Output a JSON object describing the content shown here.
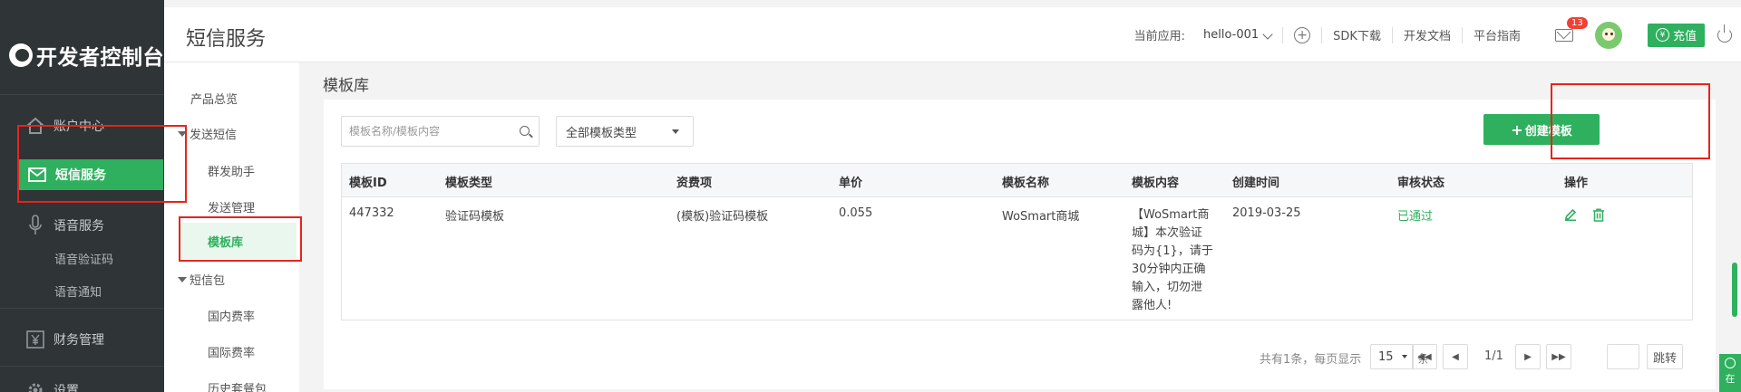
{
  "app": {
    "logo_text": "开发者控制台",
    "page_title": "短信服务"
  },
  "sidebar": {
    "items": [
      {
        "label": "账户中心",
        "icon": "home-icon"
      },
      {
        "label": "短信服务",
        "icon": "envelope-icon",
        "active": true
      },
      {
        "label": "语音服务",
        "icon": "microphone-icon"
      },
      {
        "label": "财务管理",
        "icon": "yen-icon"
      },
      {
        "label": "设置",
        "icon": "gear-icon"
      }
    ],
    "voice_sub": [
      "语音验证码",
      "语音通知"
    ]
  },
  "submenu": {
    "overview": "产品总览",
    "send_group": "发送短信",
    "send_items": [
      "群发助手",
      "发送管理",
      "模板库"
    ],
    "package_group": "短信包",
    "package_items": [
      "国内费率",
      "国际费率",
      "历史套餐包"
    ]
  },
  "header": {
    "current_app_label": "当前应用:",
    "current_app_value": "hello-001",
    "links": [
      "SDK下载",
      "开发文档",
      "平台指南"
    ],
    "mail_badge": "13",
    "recharge_label": "充值",
    "recharge_icon": "¥"
  },
  "content": {
    "title": "模板库",
    "search_placeholder": "模板名称/模板内容",
    "type_select_value": "全部模板类型",
    "create_button": "创建模板",
    "create_button_icon": "+"
  },
  "table": {
    "columns": [
      "模板ID",
      "模板类型",
      "资费项",
      "单价",
      "模板名称",
      "模板内容",
      "创建时间",
      "审核状态",
      "操作"
    ],
    "rows": [
      {
        "id": "447332",
        "type": "验证码模板",
        "fee_item": "(模板)验证码模板",
        "price": "0.055",
        "name": "WoSmart商城",
        "content_lines": [
          "【WoSmart商",
          "城】本次验证",
          "码为{1}，请于",
          "30分钟内正确",
          "输入，切勿泄",
          "露他人!"
        ],
        "created": "2019-03-25",
        "status": "已通过"
      }
    ]
  },
  "pagination": {
    "total_text": "共有1条，每页显示",
    "page_size": "15",
    "unit": "条",
    "page_info": "1/1",
    "jump_label": "跳转"
  },
  "float_tab": {
    "label": "在"
  },
  "colors": {
    "brand_green": "#2eb05e",
    "sidebar_dark": "#2f3436",
    "highlight_red": "#e8231c",
    "badge_red": "#f04134"
  }
}
